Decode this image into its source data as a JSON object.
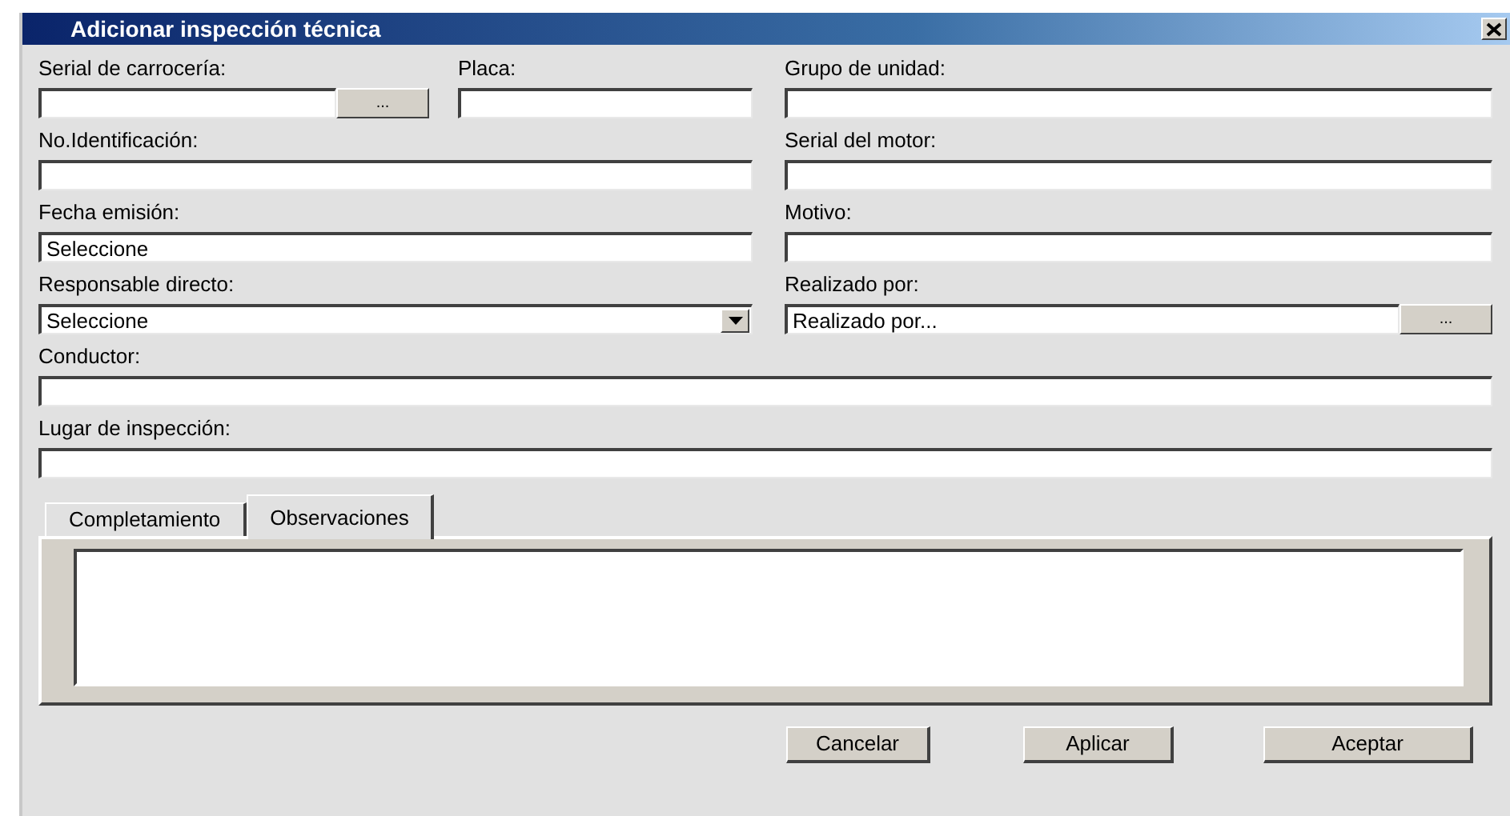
{
  "window": {
    "title": "Adicionar inspección técnica"
  },
  "rows": [
    [
      {
        "label": "Serial de carrocería:",
        "kind": "browse",
        "button": "..."
      },
      {
        "label": "Placa:",
        "kind": "text"
      },
      {
        "label": "Grupo de unidad:",
        "kind": "text"
      }
    ],
    [
      {
        "label": "No.Identificación:",
        "kind": "text"
      },
      {
        "label": "Serial del motor:",
        "kind": "text"
      }
    ],
    [
      {
        "label": "Fecha emisión:",
        "kind": "text",
        "value": "Seleccione"
      },
      {
        "label": "Motivo:",
        "kind": "text"
      }
    ],
    [
      {
        "label": "Responsable directo:",
        "kind": "select",
        "value": "Seleccione"
      },
      {
        "label": "Realizado por:",
        "kind": "browse",
        "value": "Realizado por...",
        "button": "..."
      }
    ],
    [
      {
        "label": "Conductor:",
        "kind": "text"
      }
    ],
    [
      {
        "label": "Lugar de inspección:",
        "kind": "text"
      }
    ]
  ],
  "tabs": [
    {
      "label": "Completamiento",
      "selected": false
    },
    {
      "label": "Observaciones",
      "selected": true
    }
  ],
  "buttons": [
    "Cancelar",
    "Aplicar",
    "Aceptar"
  ]
}
